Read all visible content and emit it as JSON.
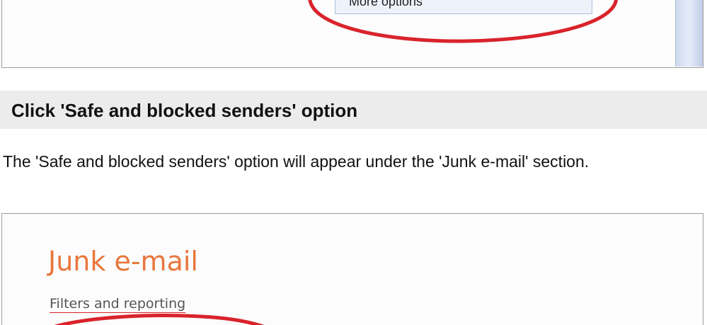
{
  "top_screenshot": {
    "menu_item_label": "More options"
  },
  "section": {
    "title": "Click 'Safe and blocked senders' option",
    "description": "The 'Safe and blocked senders' option will appear under the 'Junk e-mail' section."
  },
  "bottom_screenshot": {
    "heading": "Junk e-mail",
    "subheading": "Filters and reporting"
  },
  "colors": {
    "annotation_circle": "#d9232b",
    "junk_heading": "#e8773c",
    "section_header_bg": "#ececec"
  }
}
